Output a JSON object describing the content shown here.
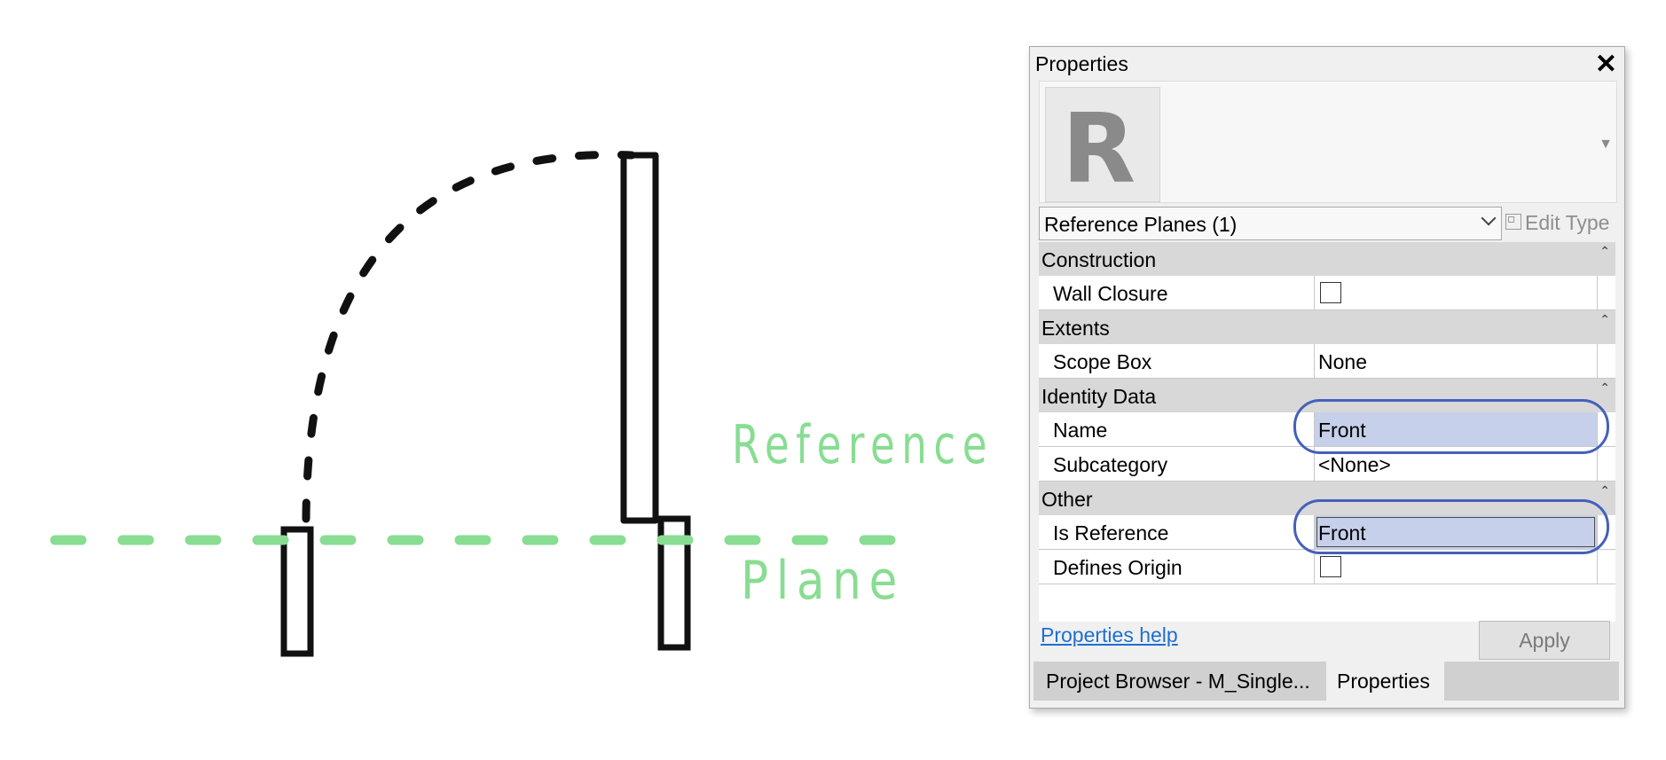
{
  "annotation": {
    "line1": "Reference",
    "line2": "Plane",
    "colors": {
      "line": "#88dd92",
      "sketch": "#111111",
      "highlight": "#4460bb"
    }
  },
  "panel": {
    "title": "Properties",
    "close_icon": "close-icon",
    "type_icon": "revit-r-logo",
    "type_selector": "Reference Planes (1)",
    "edit_type": "Edit Type",
    "groups": {
      "construction": {
        "label": "Construction",
        "rows": {
          "wall_closure": {
            "name": "Wall Closure",
            "checked": false
          }
        }
      },
      "extents": {
        "label": "Extents",
        "rows": {
          "scope_box": {
            "name": "Scope Box",
            "value": "None"
          }
        }
      },
      "identity": {
        "label": "Identity Data",
        "rows": {
          "name": {
            "name": "Name",
            "value": "Front"
          },
          "subcategory": {
            "name": "Subcategory",
            "value": "<None>"
          }
        }
      },
      "other": {
        "label": "Other",
        "rows": {
          "is_reference": {
            "name": "Is Reference",
            "value": "Front"
          },
          "defines_origin": {
            "name": "Defines Origin",
            "checked": false
          }
        }
      }
    },
    "help_link": "Properties help",
    "apply": "Apply",
    "tabs": {
      "project_browser": "Project Browser - M_Single...",
      "properties": "Properties"
    }
  }
}
